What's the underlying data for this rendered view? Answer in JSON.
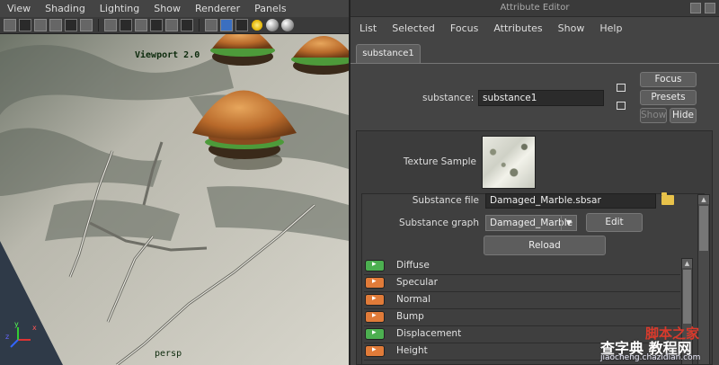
{
  "viewport": {
    "menu": [
      "View",
      "Shading",
      "Lighting",
      "Show",
      "Renderer",
      "Panels"
    ],
    "label": "Viewport 2.0",
    "camera_label": "persp",
    "axis_labels": [
      "x",
      "y",
      "z"
    ]
  },
  "attribute_editor": {
    "title": "Attribute Editor",
    "menu": [
      "List",
      "Selected",
      "Focus",
      "Attributes",
      "Show",
      "Help"
    ],
    "tab": "substance1",
    "substance_label": "substance:",
    "substance_value": "substance1",
    "focus_button": "Focus",
    "presets_button": "Presets",
    "show_button": "Show",
    "hide_button": "Hide",
    "texture_sample_label": "Texture Sample",
    "substance_file_label": "Substance file",
    "substance_file_value": "Damaged_Marble.sbsar",
    "substance_graph_label": "Substance graph",
    "substance_graph_value": "Damaged_Marble",
    "edit_button": "Edit",
    "reload_button": "Reload",
    "outputs": [
      {
        "name": "Diffuse",
        "color": "#4caf50"
      },
      {
        "name": "Specular",
        "color": "#e07b39"
      },
      {
        "name": "Normal",
        "color": "#e07b39"
      },
      {
        "name": "Bump",
        "color": "#e07b39"
      },
      {
        "name": "Displacement",
        "color": "#4caf50"
      },
      {
        "name": "Height",
        "color": "#e07b39"
      }
    ]
  },
  "watermark": {
    "line1": "脚本之家",
    "line2": "查字典 教程网",
    "url": "jiaocheng.chazidian.com"
  }
}
